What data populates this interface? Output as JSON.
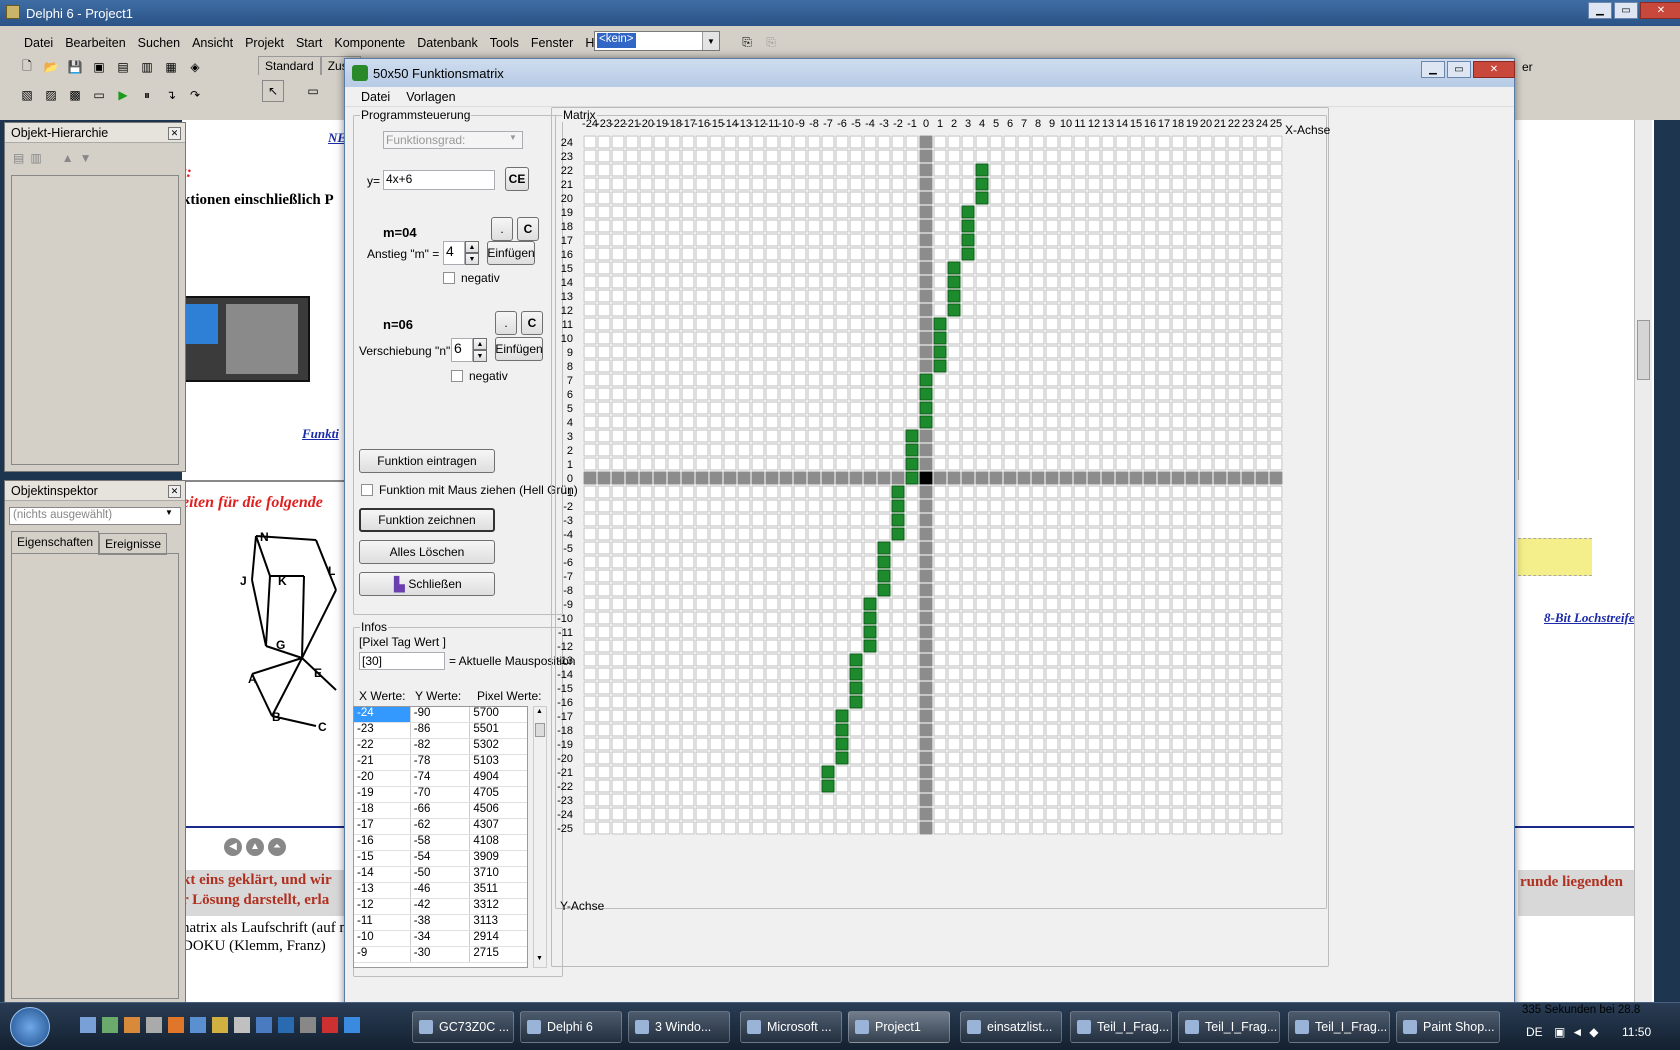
{
  "delphi": {
    "title": "Delphi 6 - Project1",
    "menu": [
      "Datei",
      "Bearbeiten",
      "Suchen",
      "Ansicht",
      "Projekt",
      "Start",
      "Komponente",
      "Datenbank",
      "Tools",
      "Fenster",
      "Hilfe"
    ],
    "combo_value": "<kein>",
    "palette_tabs": [
      "Standard",
      "Zusä"
    ],
    "hierarchy_title": "Objekt-Hierarchie",
    "inspector_title": "Objektinspektor",
    "inspector_combo": "(nichts ausgewählt)",
    "inspector_tabs": [
      "Eigenschaften",
      "Ereignisse"
    ]
  },
  "doc": {
    "ne": "NE",
    "heading_red": "t:",
    "text1": "ktionen einschließlich P",
    "funkt_link": "Funkti",
    "red_heading2": "eiten für die folgende",
    "bottom1": "kt eins geklärt, und wir",
    "bottom2": "r Lösung darstellt, erla",
    "bottom_right": "runde liegenden",
    "bottom3": "natrix als Laufschrift (auf n",
    "bottom4": "DOKU (Klemm, Franz)",
    "lochstreifen_link": "8-Bit Lochstreifen",
    "status_right": "335 Sekunden bei 28.8",
    "right_edge_char": "er",
    "graph_nodes": [
      "N",
      "J",
      "K",
      "L",
      "G",
      "A",
      "E",
      "B",
      "C"
    ]
  },
  "fwin": {
    "title": "50x50 Funktionsmatrix",
    "menu": [
      "Datei",
      "Vorlagen"
    ],
    "prog_group": "Programmsteuerung",
    "funktionsgrad_placeholder": "Funktionsgrad:",
    "y_label": "y=",
    "y_value": "4x+6",
    "ce": "CE",
    "m_display": "m=04",
    "anstieg_label": "Anstieg  \"m\" =",
    "m_value": "4",
    "dot": ".",
    "c": "C",
    "einfuegen": "Einfügen",
    "negativ": "negativ",
    "n_display": "n=06",
    "verschiebung_label": "Verschiebung \"n\" =",
    "n_value": "6",
    "funktion_eintragen": "Funktion eintragen",
    "maus_label": "Funktion mit Maus ziehen (Hell Grün)",
    "funktion_zeichnen": "Funktion zeichnen",
    "alles_loeschen": "Alles Löschen",
    "schliessen": "Schließen",
    "infos_group": "Infos",
    "pixel_tag": "[Pixel Tag Wert ]",
    "mouse_value": "[30]",
    "mouse_label": "= Aktuelle Mausposition",
    "col_x": "X Werte:",
    "col_y": "Y Werte:",
    "col_p": "Pixel Werte:",
    "rows": [
      [
        "-24",
        "-90",
        "5700"
      ],
      [
        "-23",
        "-86",
        "5501"
      ],
      [
        "-22",
        "-82",
        "5302"
      ],
      [
        "-21",
        "-78",
        "5103"
      ],
      [
        "-20",
        "-74",
        "4904"
      ],
      [
        "-19",
        "-70",
        "4705"
      ],
      [
        "-18",
        "-66",
        "4506"
      ],
      [
        "-17",
        "-62",
        "4307"
      ],
      [
        "-16",
        "-58",
        "4108"
      ],
      [
        "-15",
        "-54",
        "3909"
      ],
      [
        "-14",
        "-50",
        "3710"
      ],
      [
        "-13",
        "-46",
        "3511"
      ],
      [
        "-12",
        "-42",
        "3312"
      ],
      [
        "-11",
        "-38",
        "3113"
      ],
      [
        "-10",
        "-34",
        "2914"
      ],
      [
        "-9",
        "-30",
        "2715"
      ]
    ],
    "matrix_group": "Matrix",
    "x_axis_label": "X-Achse",
    "y_axis_label": "Y-Achse",
    "colors": {
      "filled": "#1e8a2e",
      "axis": "#8c8c8c",
      "origin": "#000000"
    }
  },
  "chart_data": {
    "type": "heatmap",
    "title": "Matrix",
    "xlabel": "X-Achse",
    "ylabel": "Y-Achse",
    "xlim": [
      -24,
      25
    ],
    "ylim": [
      -25,
      24
    ],
    "function": "y=4x+6",
    "filled_cells": [
      [
        4,
        22
      ],
      [
        4,
        21
      ],
      [
        4,
        20
      ],
      [
        3,
        19
      ],
      [
        3,
        18
      ],
      [
        3,
        17
      ],
      [
        3,
        16
      ],
      [
        2,
        15
      ],
      [
        2,
        14
      ],
      [
        2,
        13
      ],
      [
        2,
        12
      ],
      [
        1,
        11
      ],
      [
        1,
        10
      ],
      [
        1,
        9
      ],
      [
        1,
        8
      ],
      [
        0,
        7
      ],
      [
        0,
        6
      ],
      [
        0,
        5
      ],
      [
        0,
        4
      ],
      [
        -1,
        3
      ],
      [
        -1,
        2
      ],
      [
        -1,
        1
      ],
      [
        -1,
        0
      ],
      [
        -2,
        -1
      ],
      [
        -2,
        -2
      ],
      [
        -2,
        -3
      ],
      [
        -2,
        -4
      ],
      [
        -3,
        -5
      ],
      [
        -3,
        -6
      ],
      [
        -3,
        -7
      ],
      [
        -3,
        -8
      ],
      [
        -4,
        -9
      ],
      [
        -4,
        -10
      ],
      [
        -4,
        -11
      ],
      [
        -4,
        -12
      ],
      [
        -5,
        -13
      ],
      [
        -5,
        -14
      ],
      [
        -5,
        -15
      ],
      [
        -5,
        -16
      ],
      [
        -6,
        -17
      ],
      [
        -6,
        -18
      ],
      [
        -6,
        -19
      ],
      [
        -6,
        -20
      ],
      [
        -7,
        -21
      ],
      [
        -7,
        -22
      ]
    ]
  },
  "taskbar": {
    "tasks": [
      "GC73Z0C ...",
      "Delphi 6",
      "3 Windo...",
      "Microsoft ...",
      "Project1",
      "einsatzlist...",
      "Teil_I_Frag...",
      "Teil_I_Frag...",
      "Teil_I_Frag...",
      "Paint Shop..."
    ],
    "lang": "DE",
    "time": "11:50"
  }
}
